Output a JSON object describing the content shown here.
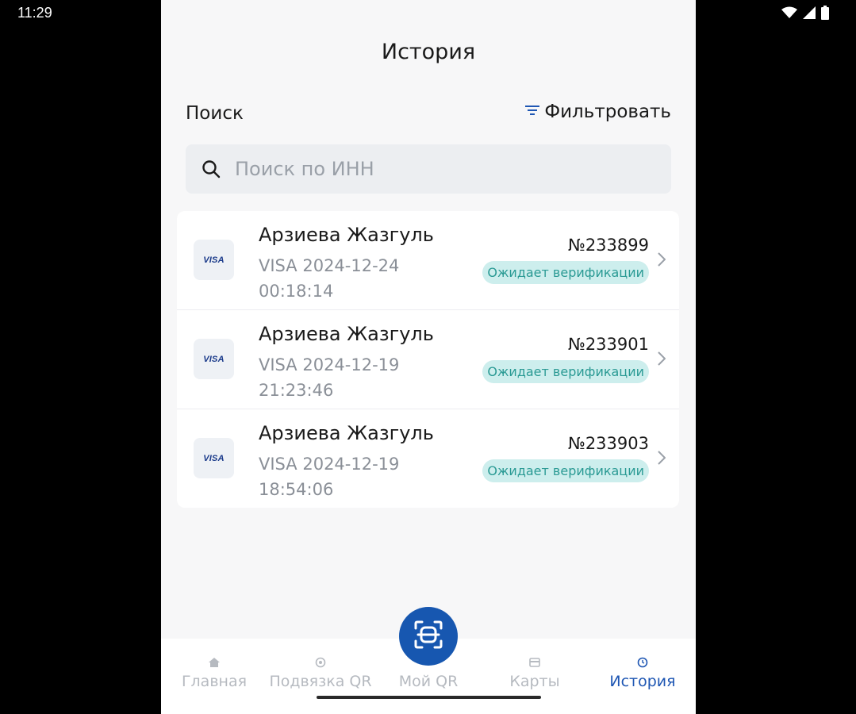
{
  "status_bar": {
    "time": "11:29"
  },
  "header": {
    "title": "История"
  },
  "search": {
    "label": "Поиск",
    "placeholder": "Поиск по ИНН",
    "filter_label": "Фильтровать"
  },
  "transactions": [
    {
      "name": "Арзиева Жазгуль",
      "card": "VISA",
      "date": "2024-12-24",
      "time": "00:18:14",
      "number": "№233899",
      "status": "Ожидает верификации"
    },
    {
      "name": "Арзиева Жазгуль",
      "card": "VISA",
      "date": "2024-12-19",
      "time": "21:23:46",
      "number": "№233901",
      "status": "Ожидает верификации"
    },
    {
      "name": "Арзиева Жазгуль",
      "card": "VISA",
      "date": "2024-12-19",
      "time": "18:54:06",
      "number": "№233903",
      "status": "Ожидает верификации"
    }
  ],
  "bottom_nav": {
    "items": [
      {
        "label": "Главная",
        "icon": "home-icon"
      },
      {
        "label": "Подвязка QR",
        "icon": "link-qr-icon"
      },
      {
        "label": "Мой QR",
        "icon": "qr-scan-icon"
      },
      {
        "label": "Карты",
        "icon": "card-icon"
      },
      {
        "label": "История",
        "icon": "history-icon",
        "active": true
      }
    ]
  },
  "colors": {
    "accent": "#1757b0",
    "status_bg": "#cdeeed",
    "status_text": "#2a9a94",
    "active_nav": "#1e56b3"
  }
}
